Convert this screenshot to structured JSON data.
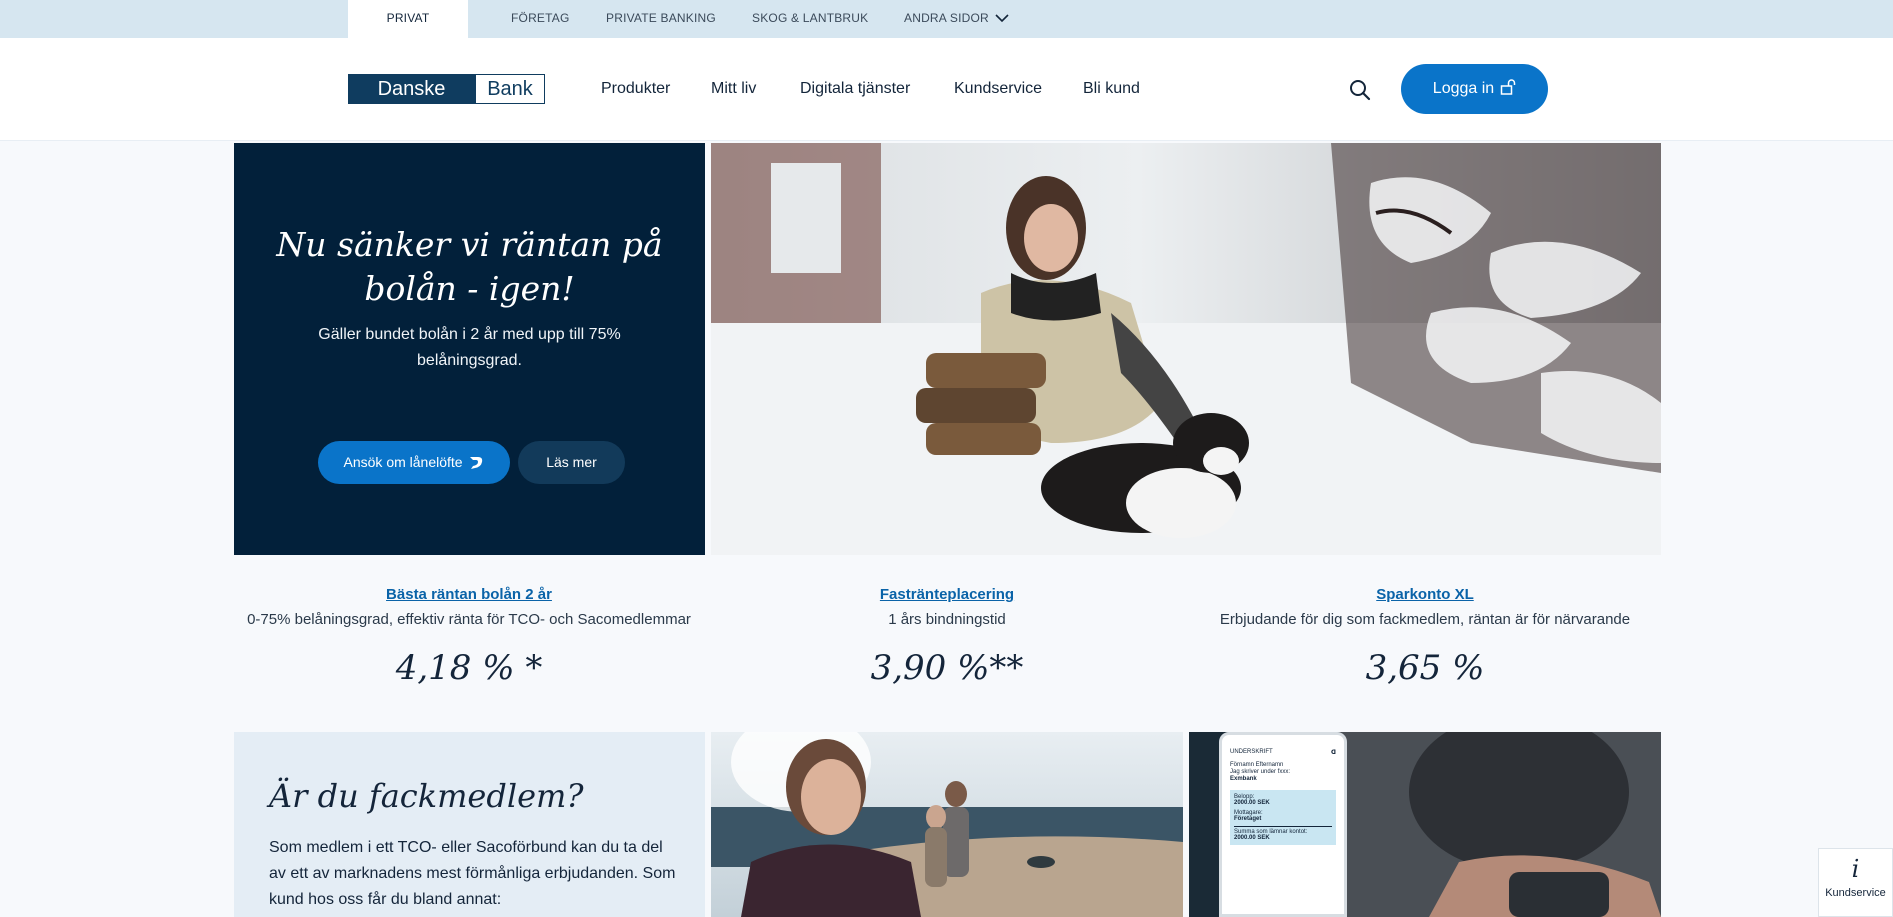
{
  "topbar": {
    "tabs": [
      "PRIVAT",
      "FÖRETAG",
      "PRIVATE BANKING",
      "SKOG & LANTBRUK",
      "ANDRA SIDOR"
    ]
  },
  "header": {
    "logo": {
      "part1": "Danske",
      "part2": "Bank"
    },
    "nav": [
      "Produkter",
      "Mitt liv",
      "Digitala tjänster",
      "Kundservice",
      "Bli kund"
    ],
    "login": "Logga in"
  },
  "hero": {
    "title": "Nu sänker vi räntan på bolån - igen!",
    "subtitle": "Gäller bundet bolån i 2 år med upp till 75% belåningsgrad.",
    "apply_button": "Ansök om lånelöfte",
    "more_button": "Läs mer"
  },
  "rates": [
    {
      "link": "Bästa räntan bolån 2 år",
      "desc": "0-75% belåningsgrad, effektiv ränta för TCO- och Sacomedlemmar",
      "value": "4,18 % *"
    },
    {
      "link": "Fastränteplacering",
      "desc": "1 års bindningstid",
      "value": "3,90 %**"
    },
    {
      "link": "Sparkonto XL",
      "desc": "Erbjudande för dig som fackmedlem, räntan är för närvarande",
      "value": "3,65 %"
    }
  ],
  "union": {
    "title": "Är du fackmedlem?",
    "text": "Som medlem i ett TCO- eller Sacoförbund kan du ta del av ett av marknadens mest förmånliga erbjudanden. Som kund hos oss får du bland annat:"
  },
  "phone": {
    "header": "UNDERSKRIFT",
    "name": "Förnamn Efternamn",
    "signs": "Jag skriver under fxxx:",
    "doc": "Exmbank",
    "amount_label": "Belopp:",
    "amount": "2000.00 SEK",
    "receiver_label": "Mottagare:",
    "receiver": "Företaget",
    "total_label": "Summa som lämnar kontot:",
    "total": "2000.00 SEK"
  },
  "widget": {
    "label": "Kundservice",
    "icon": "info-icon"
  },
  "colors": {
    "primary": "#0a74c9",
    "navy": "#02203a",
    "topbar": "#d6e6f0"
  }
}
